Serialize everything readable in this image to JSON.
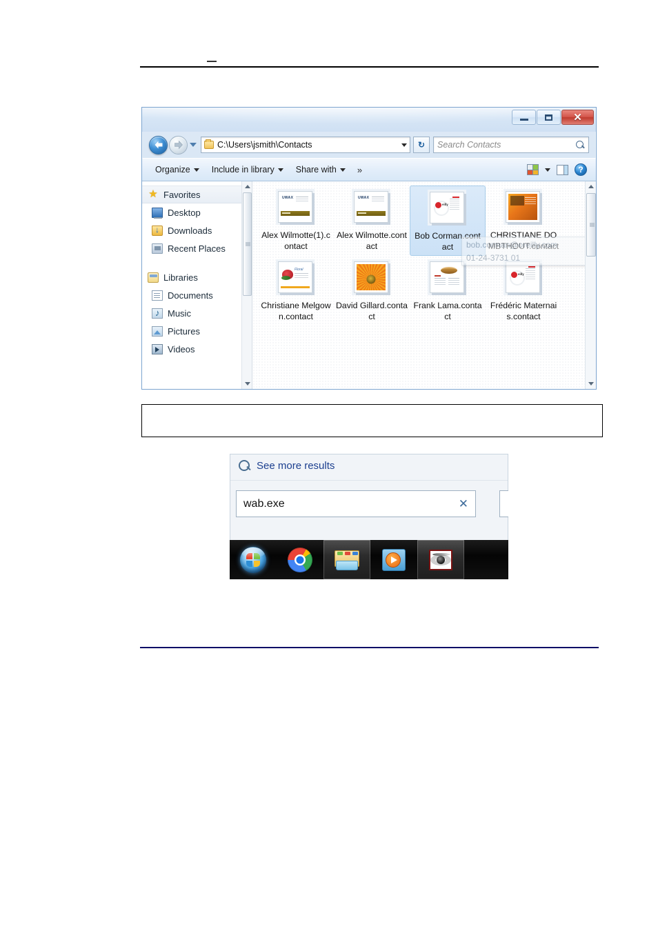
{
  "window": {
    "title_buttons": {
      "minimize": "minimize",
      "maximize": "maximize",
      "close": "✕"
    },
    "address": {
      "path": "C:\\Users\\jsmith\\Contacts",
      "folder_icon": "folder-icon",
      "back_icon": "back-arrow-icon",
      "forward_icon": "forward-arrow-icon",
      "history_icon": "history-dropdown-icon",
      "dropdown_icon": "chevron-down-icon",
      "refresh_icon": "refresh-icon",
      "refresh_glyph": "↻"
    },
    "search": {
      "placeholder": "Search Contacts",
      "icon": "search-icon"
    },
    "toolbar": {
      "organize": "Organize",
      "include_in_library": "Include in library",
      "share_with": "Share with",
      "overflow": "»",
      "views_icon": "views-icon",
      "views_caret": "chevron-down-icon",
      "preview_pane_icon": "preview-pane-icon",
      "help_icon": "help-icon",
      "help_glyph": "?"
    },
    "nav_pane": {
      "groups": [
        {
          "header": {
            "label": "Favorites",
            "icon": "star-icon",
            "selected": true
          },
          "items": [
            {
              "label": "Desktop",
              "icon": "desktop-icon"
            },
            {
              "label": "Downloads",
              "icon": "downloads-icon"
            },
            {
              "label": "Recent Places",
              "icon": "recent-places-icon"
            }
          ]
        },
        {
          "header": {
            "label": "Libraries",
            "icon": "libraries-icon",
            "selected": false
          },
          "items": [
            {
              "label": "Documents",
              "icon": "documents-icon"
            },
            {
              "label": "Music",
              "icon": "music-icon"
            },
            {
              "label": "Pictures",
              "icon": "pictures-icon"
            },
            {
              "label": "Videos",
              "icon": "videos-icon"
            }
          ]
        }
      ]
    },
    "files": [
      {
        "name": "Alex Wilmotte(1).contact",
        "art": "uwax",
        "selected": false
      },
      {
        "name": "Alex Wilmotte.contact",
        "art": "uwax",
        "selected": false
      },
      {
        "name": "Bob Corman.contact",
        "art": "reilly",
        "selected": true
      },
      {
        "name": "CHRISTIANE DOMBTHOUT.contact",
        "art": "orange",
        "selected": false
      },
      {
        "name": "Christiane Melgown.contact",
        "art": "rose",
        "selected": false
      },
      {
        "name": "David Gillard.contact",
        "art": "gerbera",
        "selected": false
      },
      {
        "name": "Frank Lama.contact",
        "art": "lama",
        "selected": false
      },
      {
        "name": "Frédéric Maternais.contact",
        "art": "reilly",
        "selected": false
      }
    ],
    "tooltip": {
      "line1": "bob.corman@oreilly.com",
      "line2": "01-24-3731 01"
    }
  },
  "search_shot": {
    "see_more_results": "See more results",
    "see_more_icon": "search-icon",
    "query_value": "wab.exe",
    "clear_icon": "close-icon",
    "clear_glyph": "✕",
    "taskbar": [
      {
        "name": "start-orb",
        "label": "Start"
      },
      {
        "name": "chrome",
        "label": "Google Chrome"
      },
      {
        "name": "windows-explorer",
        "label": "Windows Explorer"
      },
      {
        "name": "windows-media-player",
        "label": "Windows Media Player"
      },
      {
        "name": "eye-app",
        "label": "Eye"
      }
    ]
  }
}
